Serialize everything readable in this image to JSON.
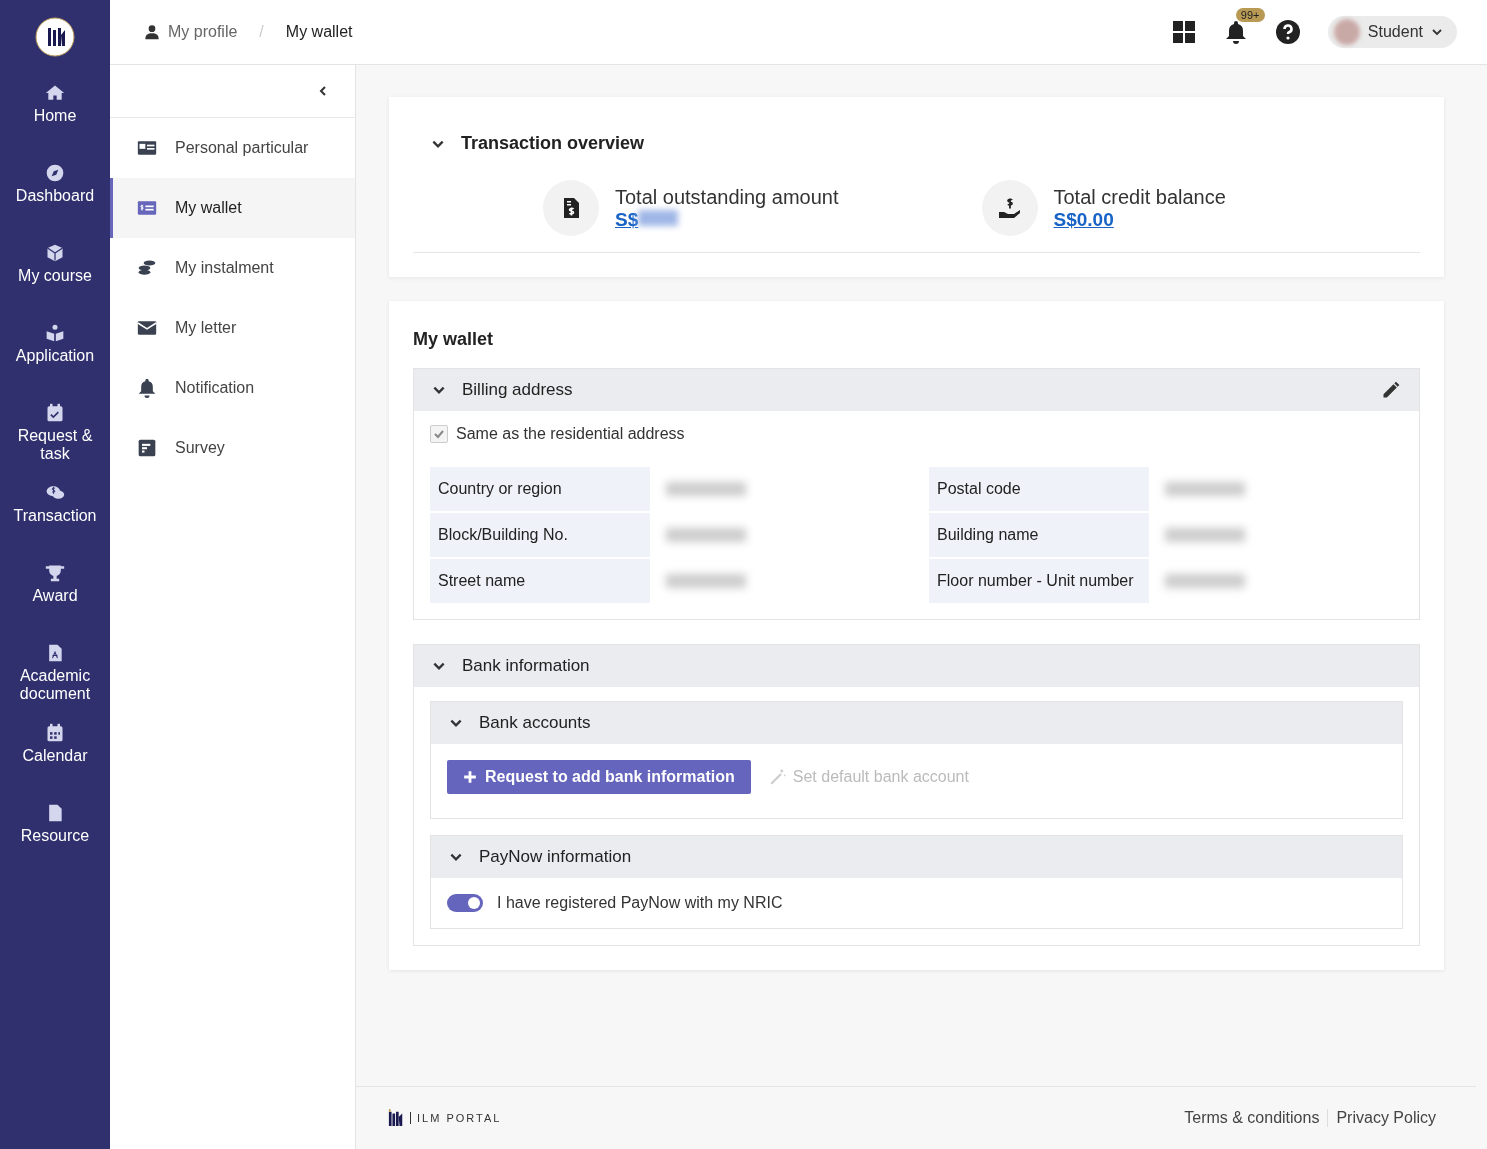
{
  "rail": {
    "items": [
      {
        "label": "Home"
      },
      {
        "label": "Dashboard"
      },
      {
        "label": "My course"
      },
      {
        "label": "Application"
      },
      {
        "label": "Request & task"
      },
      {
        "label": "Transaction"
      },
      {
        "label": "Award"
      },
      {
        "label": "Academic document"
      },
      {
        "label": "Calendar"
      },
      {
        "label": "Resource"
      }
    ]
  },
  "breadcrumb": [
    "My profile",
    "My wallet"
  ],
  "breadcrumb_separator": "/",
  "header": {
    "notification_badge": "99+",
    "user": "Student"
  },
  "subnav": {
    "items": [
      {
        "label": "Personal particular",
        "selected": false
      },
      {
        "label": "My wallet",
        "selected": true
      },
      {
        "label": "My instalment",
        "selected": false
      },
      {
        "label": "My letter",
        "selected": false
      },
      {
        "label": "Notification",
        "selected": false
      },
      {
        "label": "Survey",
        "selected": false
      }
    ]
  },
  "overview": {
    "title": "Transaction overview",
    "stats": [
      {
        "label": "Total outstanding amount",
        "value": "S$",
        "redacted": true
      },
      {
        "label": "Total credit balance",
        "value": "S$0.00",
        "redacted": false
      }
    ]
  },
  "wallet": {
    "title": "My wallet",
    "billing": {
      "title": "Billing address",
      "same_as_residential": {
        "label": "Same as the residential address",
        "checked": true
      },
      "fields": [
        {
          "label": "Country or region"
        },
        {
          "label": "Postal code"
        },
        {
          "label": "Block/Building No."
        },
        {
          "label": "Building name"
        },
        {
          "label": "Street name"
        },
        {
          "label": "Floor number - Unit number"
        }
      ]
    },
    "bank": {
      "title": "Bank information",
      "accounts": {
        "title": "Bank accounts",
        "add_button": "Request to add bank information",
        "default_button": {
          "label": "Set default bank account",
          "disabled": true
        }
      },
      "paynow": {
        "title": "PayNow information",
        "toggle": {
          "label": "I have registered PayNow with my NRIC",
          "on": true
        }
      }
    }
  },
  "footer": {
    "brand": "ILM PORTAL",
    "links": [
      "Terms & conditions",
      "Privacy Policy"
    ]
  }
}
